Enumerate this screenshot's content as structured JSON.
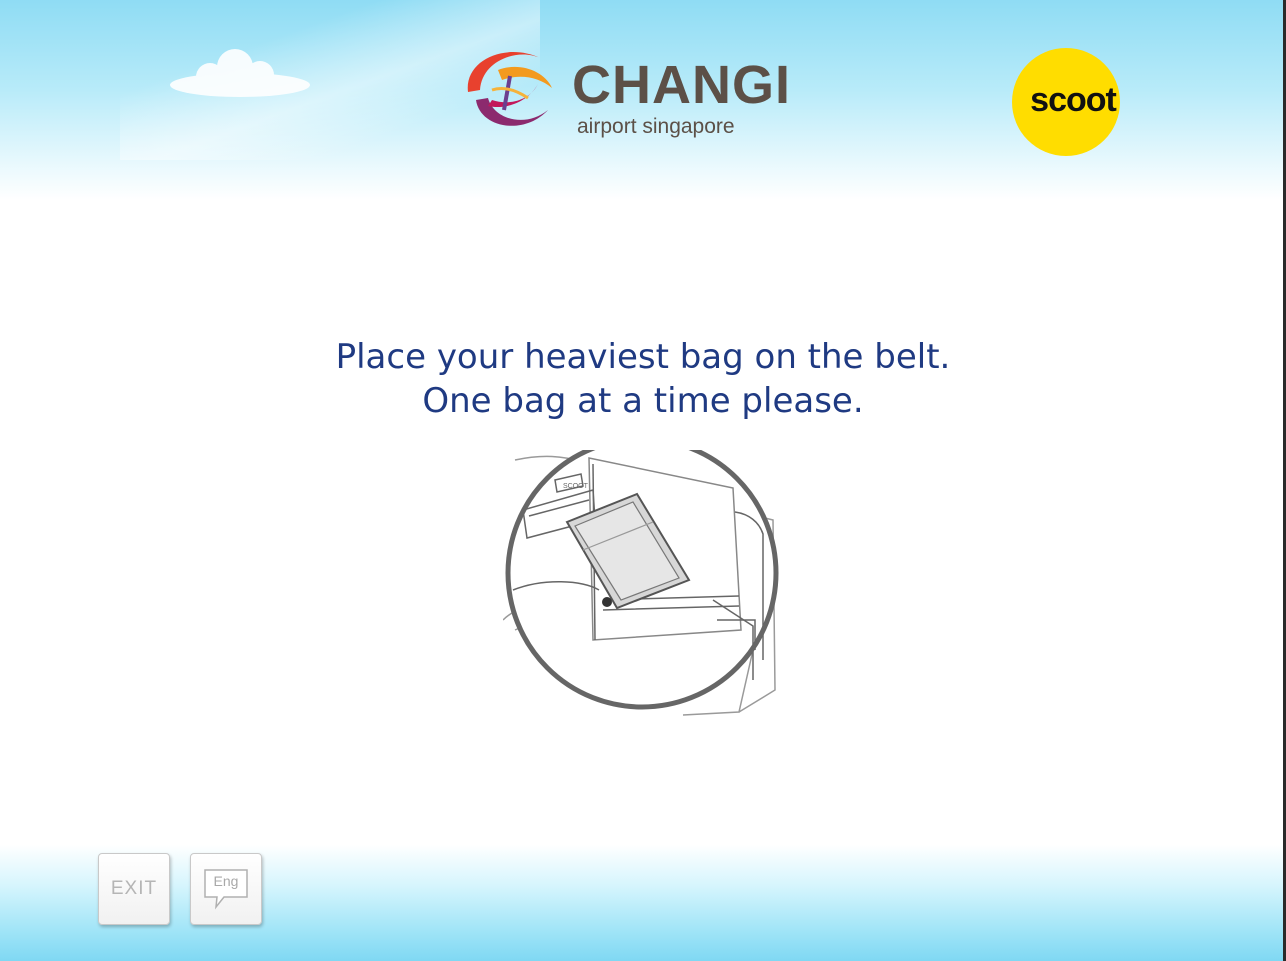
{
  "header": {
    "airport_logo": {
      "icon": "changi-swirl-icon",
      "name": "CHANGI",
      "subtitle": "airport singapore"
    },
    "airline_logo": {
      "name": "scoot",
      "color": "#ffdd00"
    }
  },
  "main": {
    "instruction_line1": "Place your heaviest bag on the belt.",
    "instruction_line2": "One bag at a time please.",
    "illustration_icon": "bag-on-belt-illustration"
  },
  "footer": {
    "exit_label": "EXIT",
    "language_label": "Eng",
    "language_icon": "speech-bubble-icon"
  },
  "colors": {
    "instruction_text": "#1f3a82",
    "sky": "#8fdcf4",
    "logo_text": "#5c5047"
  }
}
